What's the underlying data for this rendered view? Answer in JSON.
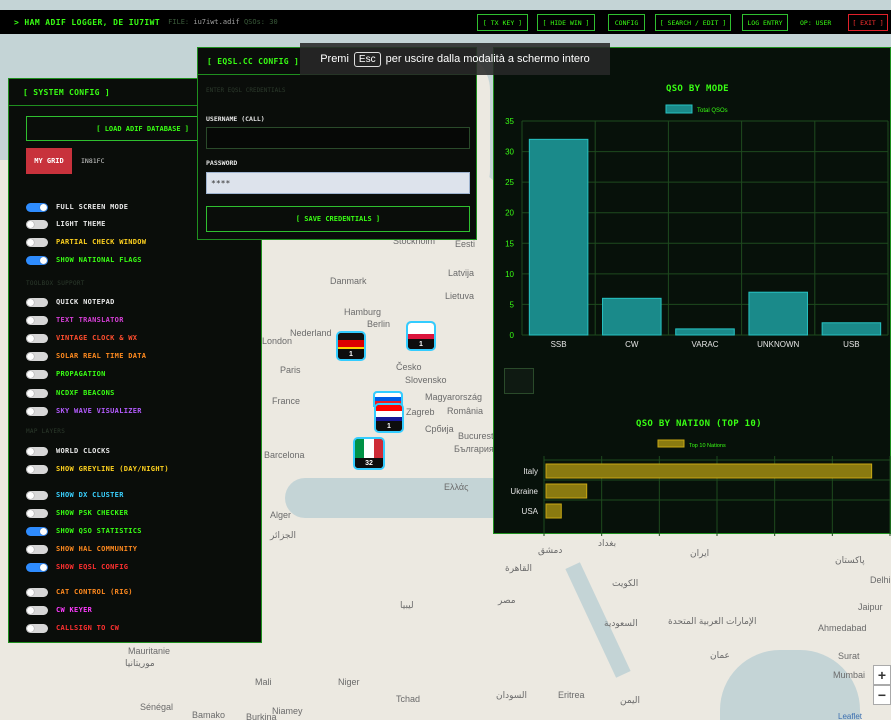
{
  "topbar": {
    "brand": "> HAM ADIF LOGGER, DE IU7IWT",
    "file_prefix": "FILE:",
    "file_name": "iu7iwt.adif",
    "file_suffix": "QSOs: 30",
    "buttons": {
      "tx_key": "[ TX KEY ]",
      "hide_win": "[ HIDE WIN ]",
      "config": "CONFIG",
      "search_edit": "[ SEARCH / EDIT ]",
      "log_entry": "LOG ENTRY",
      "operator": "OP: USER",
      "exit": "[ EXIT ]"
    }
  },
  "toast": {
    "before": "Premi",
    "key": "Esc",
    "after": "per uscire dalla modalità a schermo intero"
  },
  "system_config": {
    "title": "[ SYSTEM CONFIG ]",
    "load_button": "[ LOAD ADIF DATABASE ]",
    "grid_button": "MY GRID",
    "grid_value": "IN81FC",
    "section_toolbox": "TOOLBOX SUPPORT",
    "section_map": "MAP LAYERS",
    "toggles": [
      {
        "label": "FULL SCREEN MODE",
        "on": true,
        "color": "#e8e8e8"
      },
      {
        "label": "LIGHT THEME",
        "on": false,
        "color": "#e8e8e8"
      },
      {
        "label": "PARTIAL CHECK WINDOW",
        "on": false,
        "color": "#ffd21f"
      },
      {
        "label": "SHOW NATIONAL FLAGS",
        "on": true,
        "color": "#39ff14"
      },
      {
        "label": "QUICK NOTEPAD",
        "on": false,
        "color": "#e8e8e8"
      },
      {
        "label": "TEXT TRANSLATOR",
        "on": false,
        "color": "#d63fd6"
      },
      {
        "label": "VINTAGE CLOCK & WX",
        "on": false,
        "color": "#ff4d2e"
      },
      {
        "label": "SOLAR REAL TIME DATA",
        "on": false,
        "color": "#ff8a1f"
      },
      {
        "label": "PROPAGATION",
        "on": false,
        "color": "#39ff14"
      },
      {
        "label": "NCDXF BEACONS",
        "on": false,
        "color": "#39ff14"
      },
      {
        "label": "SKY WAVE VISUALIZER",
        "on": false,
        "color": "#b45cff"
      },
      {
        "label": "WORLD CLOCKS",
        "on": false,
        "color": "#e8e8e8"
      },
      {
        "label": "SHOW GREYLINE (DAY/NIGHT)",
        "on": false,
        "color": "#ffd21f"
      },
      {
        "label": "SHOW DX CLUSTER",
        "on": false,
        "color": "#3ad1ff"
      },
      {
        "label": "SHOW PSK CHECKER",
        "on": false,
        "color": "#39ff14"
      },
      {
        "label": "SHOW QSO STATISTICS",
        "on": true,
        "color": "#39ff14"
      },
      {
        "label": "SHOW HAL COMMUNITY",
        "on": false,
        "color": "#ff8a1f"
      },
      {
        "label": "SHOW EQSL CONFIG",
        "on": true,
        "color": "#ff3030"
      },
      {
        "label": "CAT CONTROL (RIG)",
        "on": false,
        "color": "#ff8a1f"
      },
      {
        "label": "CW KEYER",
        "on": false,
        "color": "#ff3cff"
      },
      {
        "label": "CALLSIGN TO CW",
        "on": false,
        "color": "#ff3030"
      }
    ]
  },
  "eqsl": {
    "title": "[ EQSL.CC CONFIG ]",
    "note": "ENTER EQSL CREDENTIALS",
    "username_label": "USERNAME (CALL)",
    "username_value": "",
    "password_label": "PASSWORD",
    "password_value": "****",
    "save_button": "[ SAVE CREDENTIALS ]"
  },
  "flags": [
    {
      "country": "Germany",
      "count": "1"
    },
    {
      "country": "Poland",
      "count": "1"
    },
    {
      "country": "Slovenia",
      "count": ""
    },
    {
      "country": "Croatia",
      "count": "1"
    },
    {
      "country": "Italy",
      "count": "32"
    }
  ],
  "map_labels": [
    "Danmark",
    "Hamburg",
    "Berlin",
    "Nederland",
    "Paris",
    "France",
    "Česko",
    "Slovensko",
    "Magyarország",
    "Zagreb",
    "România",
    "Србија",
    "Bucuresti",
    "България",
    "Barcelona",
    "Ελλάς",
    "Latvija",
    "Lietuva",
    "Stockholm",
    "Eesti",
    "Alger",
    "الجزائر",
    "Mauritanie",
    "موريتانيا",
    "Mali",
    "Niger",
    "Tchad",
    "Sénégal",
    "Bamako",
    "Niamey",
    "Burkina",
    "السودان",
    "دمشق",
    "القاهرة",
    "مصر",
    "ليبيا",
    "بغداد",
    "الكويت",
    "السعودية",
    "الإمارات العربية المتحدة",
    "عمان",
    "اليمن",
    "Ahmedabad",
    "Surat",
    "Mumbai",
    "Delhi",
    "Jaipur",
    "پاکستان",
    "ایران",
    "Eritrea",
    "London",
    "Leaflet"
  ],
  "chart_data": [
    {
      "type": "bar",
      "title": "QSO BY MODE",
      "legend": "Total QSOs",
      "categories": [
        "SSB",
        "CW",
        "VARAC",
        "UNKNOWN",
        "USB"
      ],
      "values": [
        32,
        6,
        1,
        7,
        2
      ],
      "ylim": [
        0,
        35
      ],
      "yticks": [
        0,
        5,
        10,
        15,
        20,
        25,
        30,
        35
      ],
      "grid": true,
      "bar_color": "#1a8a8a",
      "bar_edge": "#27c2c2"
    },
    {
      "type": "bar",
      "orientation": "horizontal",
      "title": "QSO BY NATION (TOP 10)",
      "legend": "Top 10 Nations",
      "categories": [
        "Italy",
        "Ukraine",
        "USA"
      ],
      "values": [
        32,
        4,
        1.5
      ],
      "xlim": [
        0,
        34
      ],
      "grid": true,
      "bar_color": "#8a7a10",
      "bar_edge": "#c8a814"
    }
  ]
}
